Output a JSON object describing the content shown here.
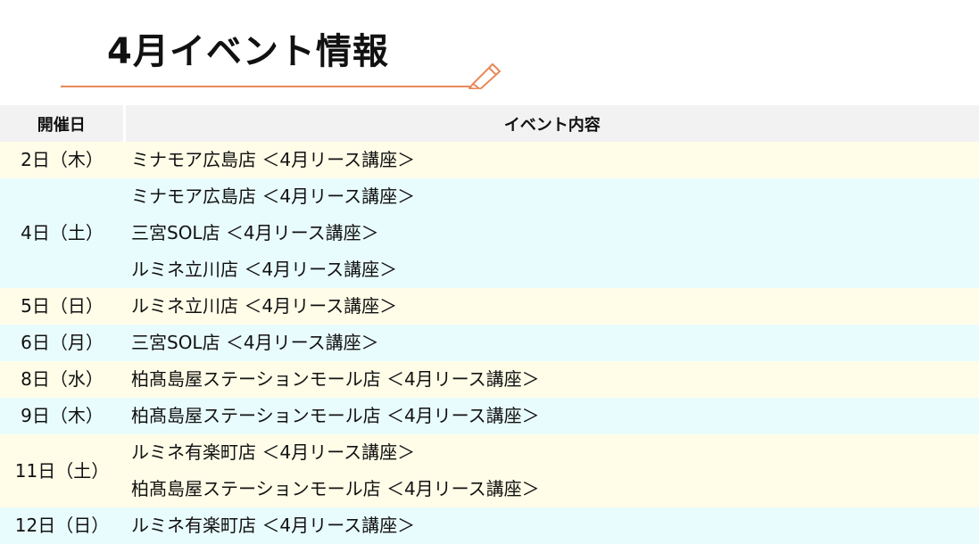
{
  "title": "4月イベント情報",
  "colors": {
    "accent": "#e8895a",
    "header_bg": "#f2f2f2",
    "row_yellow": "#fffde8",
    "row_blue": "#e9fcfd"
  },
  "icon": "pencil-icon",
  "table": {
    "headers": [
      "開催日",
      "イベント内容"
    ],
    "rows": [
      {
        "date": "2日（木）",
        "events": [
          "ミナモア広島店 ＜4月リース講座＞"
        ]
      },
      {
        "date": "4日（土）",
        "events": [
          "ミナモア広島店 ＜4月リース講座＞",
          "三宮SOL店 ＜4月リース講座＞",
          "ルミネ立川店 ＜4月リース講座＞"
        ]
      },
      {
        "date": "5日（日）",
        "events": [
          "ルミネ立川店 ＜4月リース講座＞"
        ]
      },
      {
        "date": "6日（月）",
        "events": [
          "三宮SOL店 ＜4月リース講座＞"
        ]
      },
      {
        "date": "8日（水）",
        "events": [
          "柏髙島屋ステーションモール店 ＜4月リース講座＞"
        ]
      },
      {
        "date": "9日（木）",
        "events": [
          "柏髙島屋ステーションモール店 ＜4月リース講座＞"
        ]
      },
      {
        "date": "11日（土）",
        "events": [
          "ルミネ有楽町店 ＜4月リース講座＞",
          "柏髙島屋ステーションモール店 ＜4月リース講座＞"
        ]
      },
      {
        "date": "12日（日）",
        "events": [
          "ルミネ有楽町店 ＜4月リース講座＞"
        ]
      }
    ]
  }
}
